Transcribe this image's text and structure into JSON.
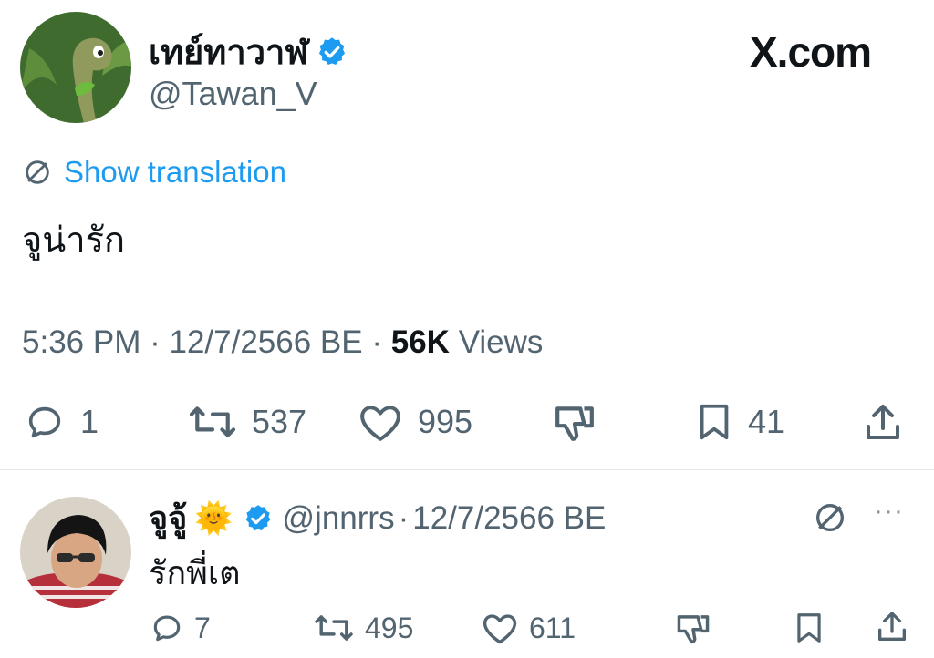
{
  "site": {
    "brand": "X.com"
  },
  "tweet": {
    "author": {
      "name": "เทย์ทาวาฬ",
      "handle": "@Tawan_V",
      "verified": true
    },
    "translate_label": "Show translation",
    "text": "จูน่ารัก",
    "time": "5:36 PM",
    "date": "12/7/2566 BE",
    "views_count": "56K",
    "views_label": "Views",
    "sep": "·",
    "actions": {
      "replies": "1",
      "reposts": "537",
      "likes": "995",
      "bookmarks": "41"
    }
  },
  "reply": {
    "author": {
      "name": "จูจู้",
      "emoji": "🌞",
      "handle": "@jnnrrs",
      "verified": true
    },
    "sep": "·",
    "date": "12/7/2566 BE",
    "text": "รักพี่เต",
    "more": "···",
    "actions": {
      "replies": "7",
      "reposts": "495",
      "likes": "611"
    }
  },
  "colors": {
    "accent": "#1d9bf0",
    "muted": "#536471",
    "text": "#0f1419"
  }
}
